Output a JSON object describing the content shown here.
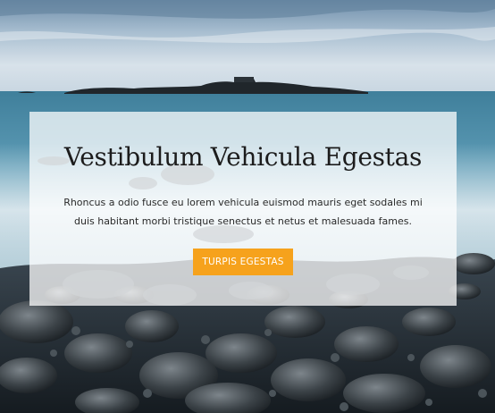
{
  "hero": {
    "title": "Vestibulum Vehicula Egestas",
    "description": "Rhoncus a odio fusce eu lorem vehicula euismod mauris eget sodales mi duis habitant morbi tristique senectus et netus et malesuada fames.",
    "button_label": "TURPIS EGESTAS"
  },
  "colors": {
    "accent": "#f6a21c",
    "title_text": "#1c1c1c",
    "body_text": "#2a2a2a",
    "card_overlay": "#ffffff"
  }
}
